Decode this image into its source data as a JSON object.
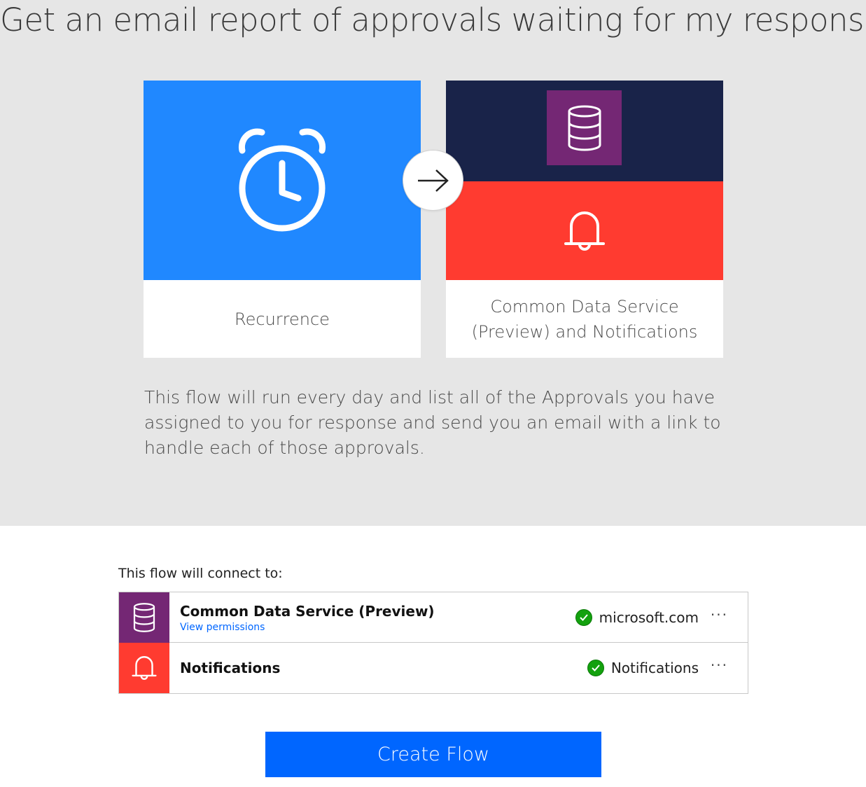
{
  "page": {
    "title": "Get an email report of approvals waiting for my response"
  },
  "cards": {
    "trigger": {
      "label": "Recurrence",
      "icon": "alarm-clock-icon",
      "color": "#2088ff"
    },
    "actions": {
      "label": "Common Data Service (Preview) and Notifications",
      "top_icon": "database-icon",
      "top_color": "#192349",
      "tile_color": "#742774",
      "bottom_icon": "bell-icon",
      "bottom_color": "#ff3b30"
    },
    "connector_icon": "arrow-right-icon"
  },
  "description": "This flow will run every day and list all of the Approvals you have assigned to you for response and send you an email with a link to handle each of those approvals.",
  "connections": {
    "heading": "This flow will connect to:",
    "rows": [
      {
        "name": "Common Data Service (Preview)",
        "link": "View permissions",
        "status": "microsoft.com",
        "icon": "database-icon",
        "color": "#742774"
      },
      {
        "name": "Notifications",
        "status": "Notifications",
        "icon": "bell-icon",
        "color": "#ff3b30"
      }
    ],
    "more_label": "···"
  },
  "actions": {
    "create_label": "Create Flow",
    "create_color": "#0066ff"
  }
}
